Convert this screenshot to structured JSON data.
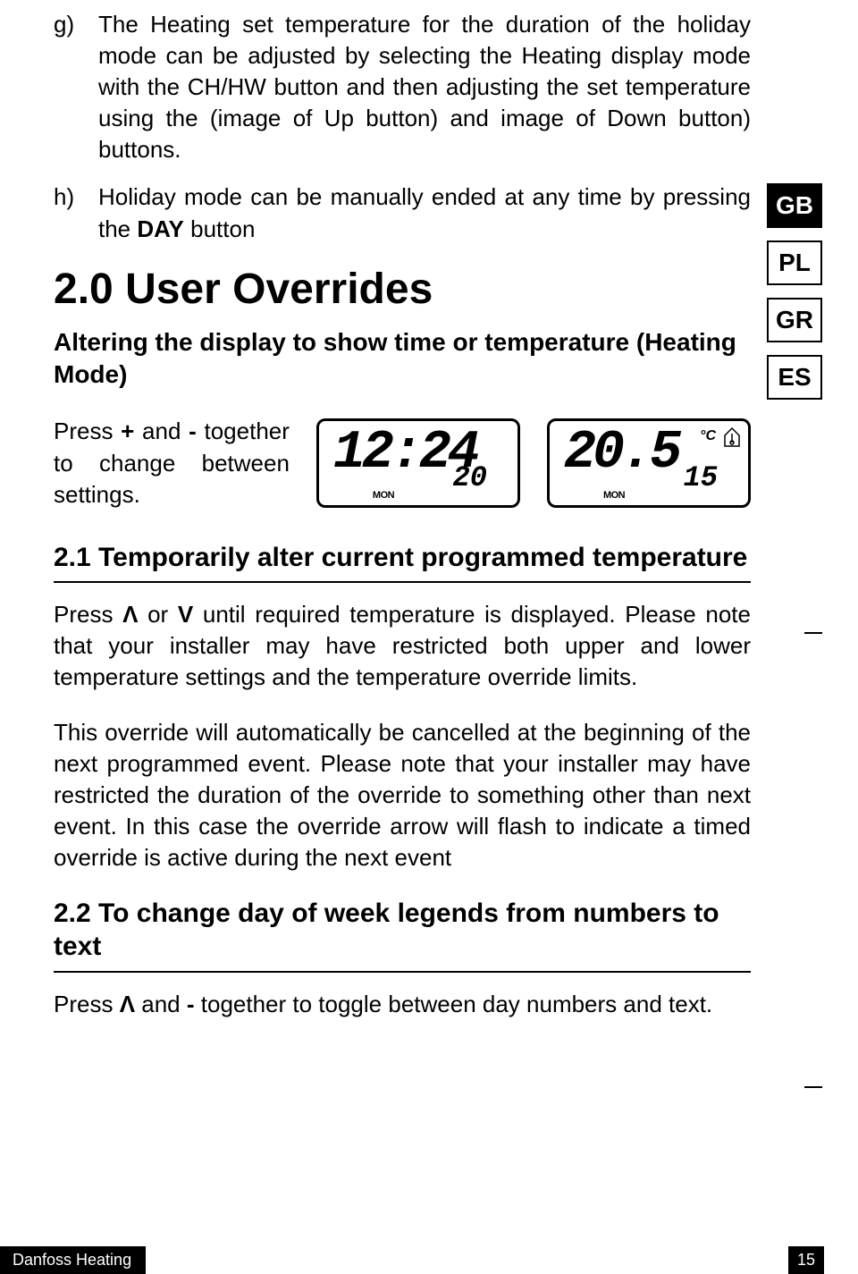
{
  "list": {
    "g": {
      "label": "g)",
      "text_before": "The Heating set temperature for the duration of the holiday mode can be adjusted by selecting the Heating display mode with the CH/HW button and then adjusting the set temperature using the (image of Up button) and image of Down button) buttons."
    },
    "h": {
      "label": "h)",
      "text_before": "Holiday mode can be manually ended at any time by pressing the ",
      "bold": "DAY",
      "text_after": " button"
    }
  },
  "h1": "2.0 User Overrides",
  "sub1": "Altering the display to show time or temperature (Heating Mode)",
  "press_row": {
    "before": "Press ",
    "plus": "+",
    "mid1": " and ",
    "minus": "-",
    "after": " together to change between settings."
  },
  "lcd1": {
    "main": "12:24",
    "sub": "20",
    "day": "MON"
  },
  "lcd2": {
    "main": "20.5",
    "sub": "15",
    "day": "MON",
    "unit": "°C"
  },
  "h2a": "2.1 Temporarily alter current programmed temperature",
  "para1": {
    "p1": "Press ",
    "up": "Λ",
    "p2": " or ",
    "down": "V",
    "p3": " until required temperature is displayed. Please note that your installer may have restricted both upper and lower temperature settings and the temperature override limits."
  },
  "para2": "This override will automatically be cancelled at the beginning of the next programmed event. Please note that your installer may have restricted the duration of the override to something other than next event. In this case the override arrow will flash to indicate a timed override is active during the next event",
  "h2b": "2.2 To change day of week legends from numbers to text",
  "para3": {
    "p1": "Press ",
    "up": "Λ",
    "p2": " and ",
    "minus": "-",
    "p3": " together to toggle between day numbers and text."
  },
  "langs": {
    "gb": "GB",
    "pl": "PL",
    "gr": "GR",
    "es": "ES"
  },
  "footer": {
    "left": "Danfoss Heating",
    "right": "15"
  }
}
